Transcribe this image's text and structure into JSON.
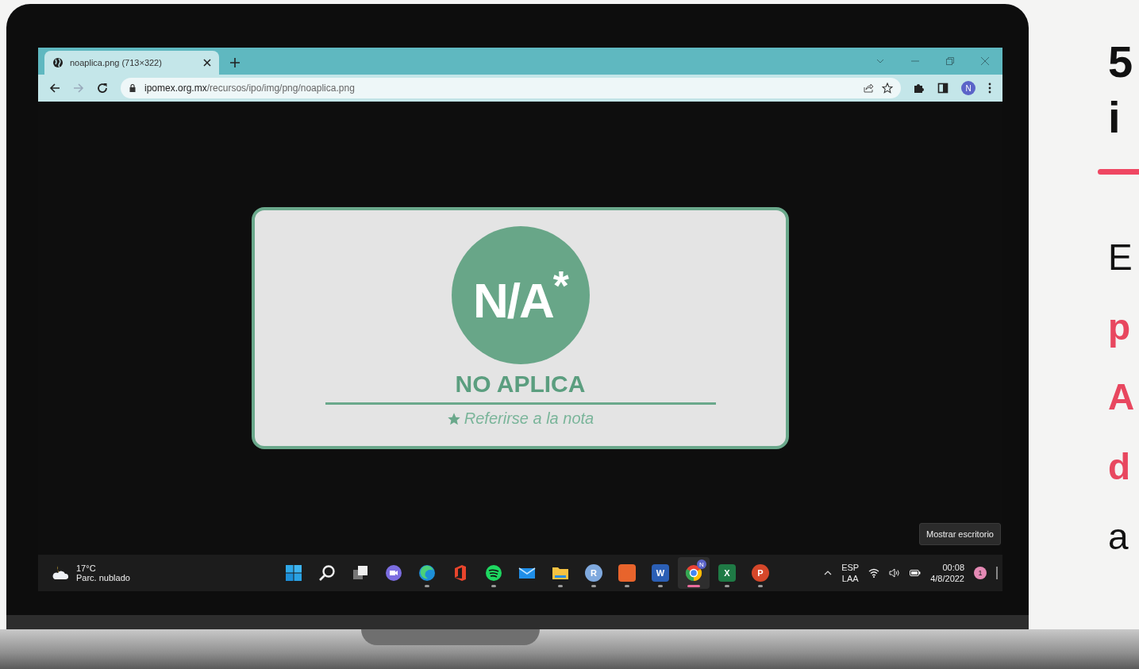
{
  "browser": {
    "tab": {
      "title": "noaplica.png (713×322)",
      "selected": true
    },
    "navigation": {
      "forward_enabled": false
    },
    "address": {
      "host": "ipomex.org.mx",
      "path": "/recursos/ipo/img/png/noaplica.png"
    },
    "profile": {
      "initial": "N"
    }
  },
  "image": {
    "badge": "N/A$^{*}$",
    "label": "NO APLICA",
    "note": "Referirse a la nota"
  },
  "tooltip": "Mostrar escritorio",
  "taskbar": {
    "weather": {
      "temperature": "17°C",
      "condition": "Parc. nublado"
    },
    "apps": [
      {
        "kind": "start",
        "running": false,
        "selected": false
      },
      {
        "kind": "search",
        "running": false,
        "selected": false
      },
      {
        "kind": "taskview",
        "running": false,
        "selected": false
      },
      {
        "kind": "chat",
        "running": false,
        "selected": false
      },
      {
        "kind": "edge",
        "running": true,
        "selected": false
      },
      {
        "kind": "office",
        "running": false,
        "selected": false
      },
      {
        "kind": "spotify",
        "running": true,
        "selected": false
      },
      {
        "kind": "mail",
        "running": false,
        "selected": false
      },
      {
        "kind": "folder",
        "running": true,
        "selected": false
      },
      {
        "kind": "letter",
        "glyph": "R",
        "color": "#7fa9de",
        "running": true,
        "selected": false
      },
      {
        "kind": "tile",
        "color": "#e8642c",
        "running": true,
        "selected": false
      },
      {
        "kind": "tile",
        "glyph": "W",
        "color": "#2b5fb5",
        "running": true,
        "selected": false
      },
      {
        "kind": "chrome",
        "glyph": "N",
        "running": true,
        "selected": true
      },
      {
        "kind": "tile",
        "glyph": "X",
        "color": "#1f7a45",
        "running": true,
        "selected": false
      },
      {
        "kind": "letter",
        "glyph": "P",
        "color": "#d5472a",
        "running": true,
        "selected": false
      }
    ],
    "language": [
      "ESP",
      "LAA"
    ],
    "time": "00:08",
    "date": "4/8/2022",
    "notifications": "1"
  },
  "slide": {
    "heading_lines": [
      "5",
      "i"
    ],
    "body_lines": [
      {
        "text": "E",
        "emphasis": false
      },
      {
        "text": "p",
        "emphasis": true
      },
      {
        "text": "A",
        "emphasis": true
      },
      {
        "text": "d",
        "emphasis": true
      },
      {
        "text": "a",
        "emphasis": false
      }
    ]
  }
}
